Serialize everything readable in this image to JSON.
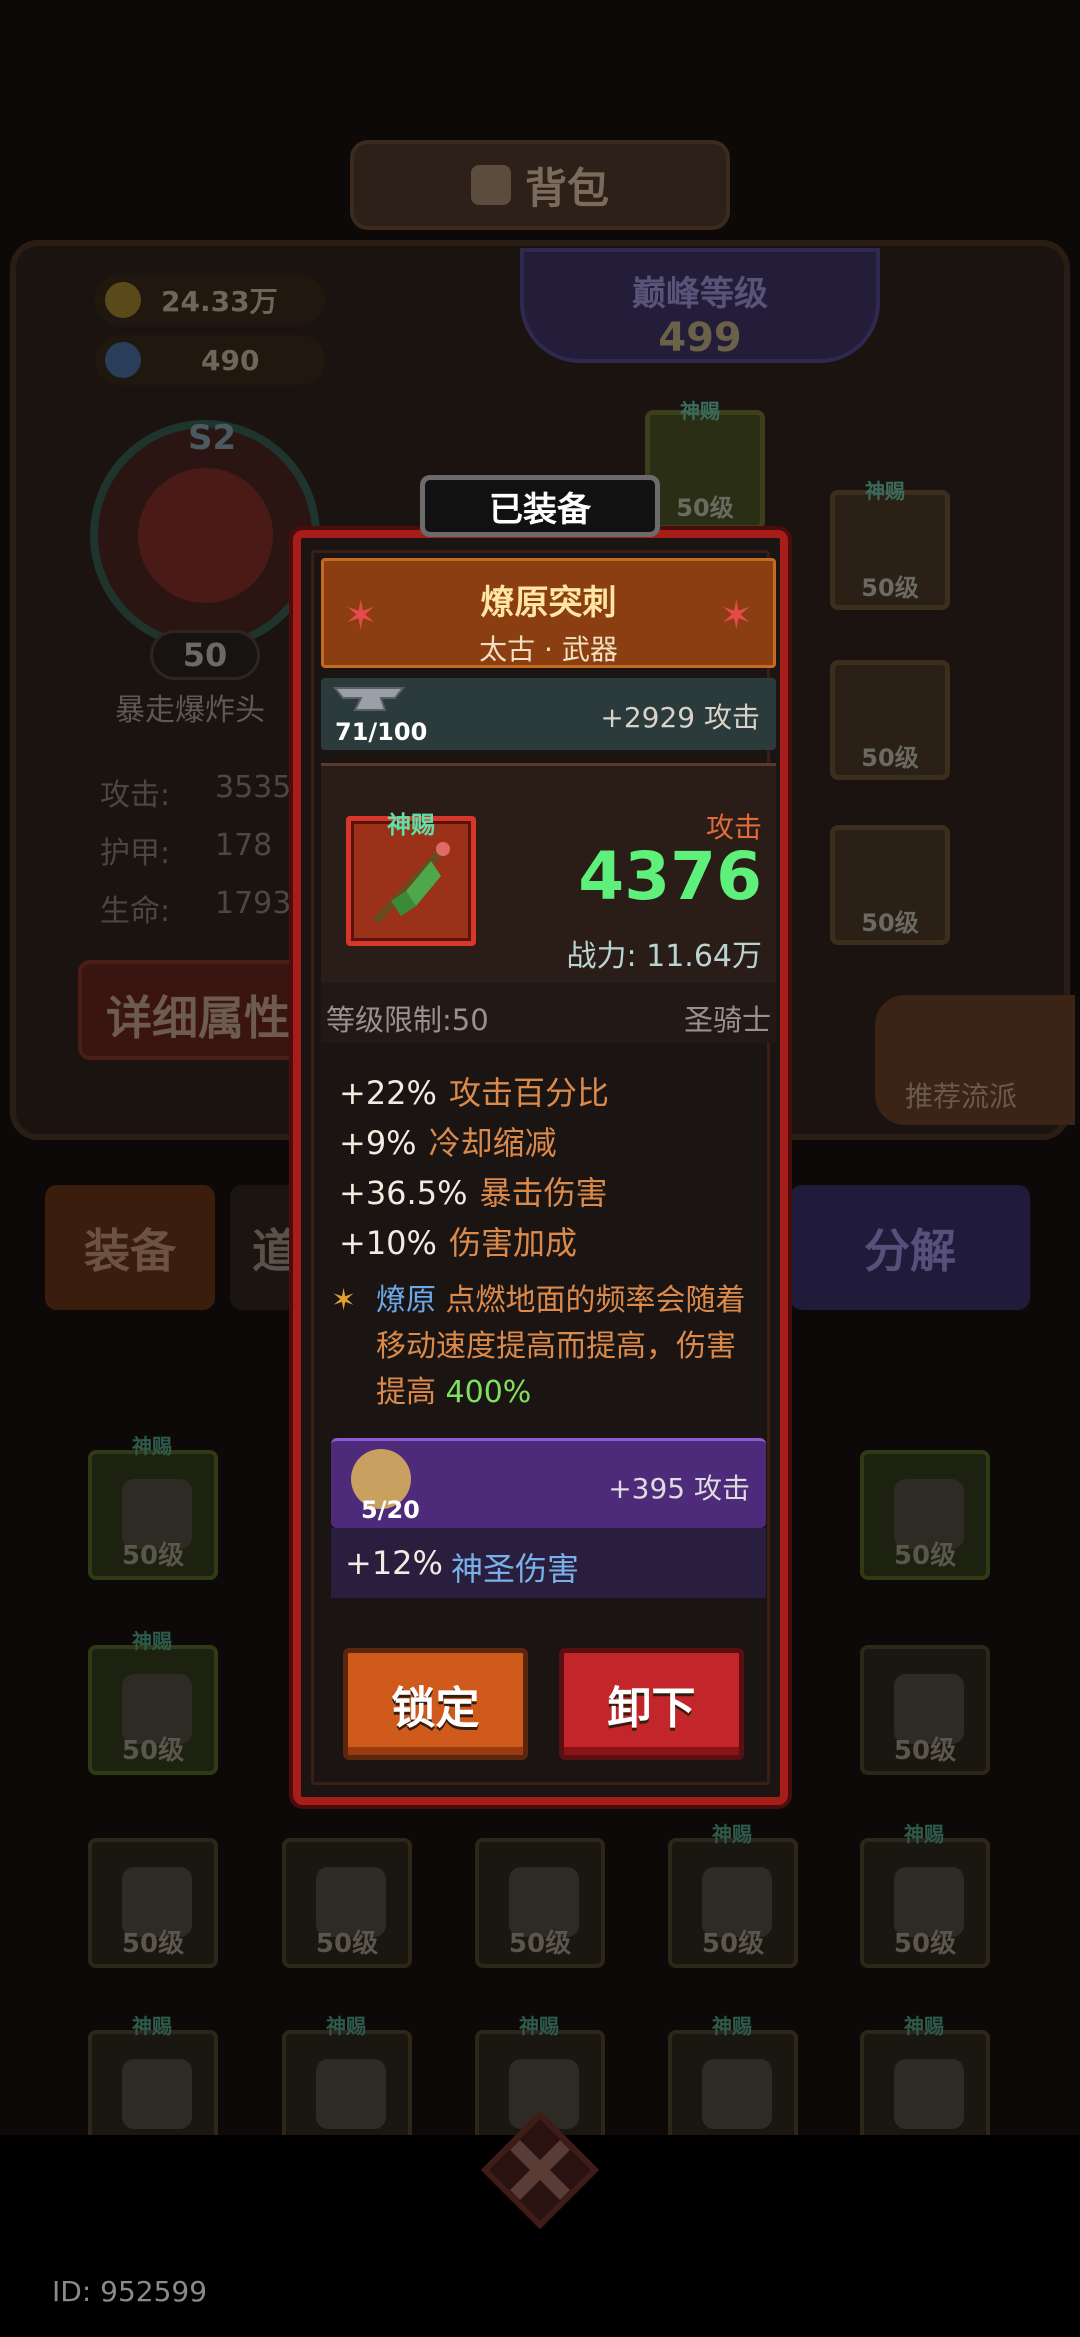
{
  "background": {
    "title": "背包",
    "currencies": [
      {
        "value": "24.33万",
        "icon": "coin-icon"
      },
      {
        "value": "490",
        "icon": "gem-icon"
      }
    ],
    "peak_label": "巅峰等级",
    "peak_value": "499",
    "hero_level": "50",
    "hero_season": "S2",
    "hero_name": "暴走爆炸头",
    "stats": [
      {
        "label": "攻击:",
        "value": "3535"
      },
      {
        "label": "护甲:",
        "value": "178"
      },
      {
        "label": "生命:",
        "value": "1793"
      }
    ],
    "detail_button": "详细属性",
    "recommend_button": "推荐流派",
    "equip_slot_gift": "神赐",
    "equip_slot_level": "50级",
    "tabs": {
      "equip": "装备",
      "item": "道",
      "split": "分解"
    },
    "inventory_level": "50级",
    "inventory_gift": "神赐",
    "id_label": "ID: 952599"
  },
  "popup": {
    "equipped_tag": "已装备",
    "name": "燎原突刺",
    "subtitle": "太古 · 武器",
    "enhance_progress": "71/100",
    "enhance_bonus": "+2929 攻击",
    "item_tag": "神赐",
    "attack_label": "攻击",
    "attack_value": "4376",
    "power": "战力: 11.64万",
    "level_req": "等级限制:50",
    "class_req": "圣骑士",
    "bonuses": [
      {
        "value": "+22%",
        "desc": "攻击百分比"
      },
      {
        "value": "+9%",
        "desc": "冷却缩减"
      },
      {
        "value": "+36.5%",
        "desc": "暴击伤害"
      },
      {
        "value": "+10%",
        "desc": "伤害加成"
      }
    ],
    "effect": {
      "keyword": "燎原",
      "text": "点燃地面的频率会随着移动速度提高而提高，伤害提高",
      "percent": "400%"
    },
    "rune_progress": "5/20",
    "rune_bonus": "+395 攻击",
    "rune_attr_value": "+12%",
    "rune_attr_desc": "神圣伤害",
    "lock_button": "锁定",
    "unequip_button": "卸下"
  },
  "colors": {
    "frame_red": "#a61d1a",
    "attack_green": "#5ef07a",
    "bonus_orange": "#dc8a4a",
    "keyword_blue": "#6aa8e8"
  }
}
